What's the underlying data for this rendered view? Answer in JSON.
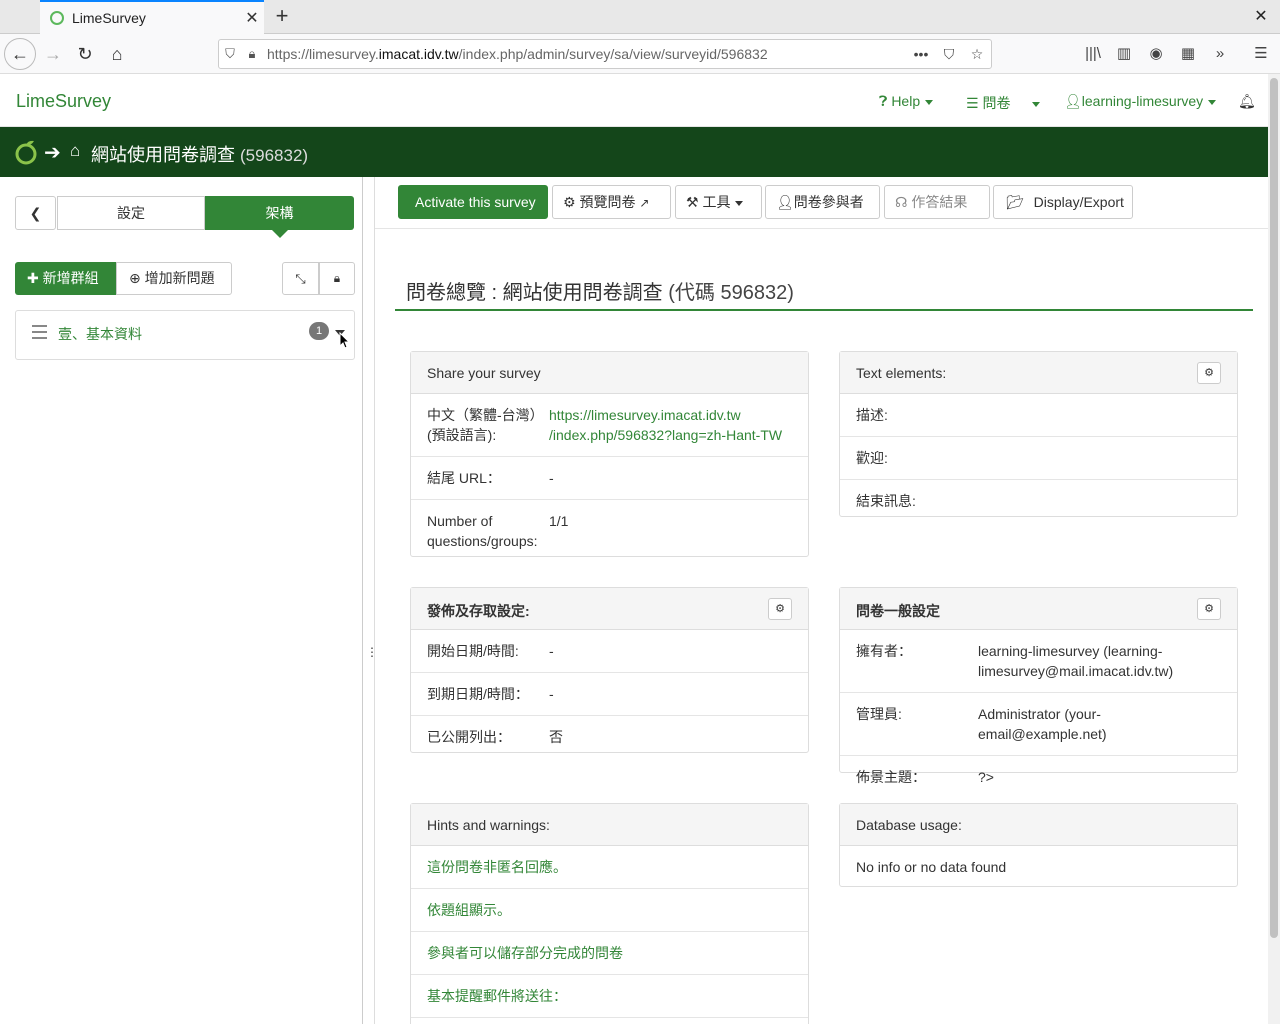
{
  "browser": {
    "tab_title": "LimeSurvey",
    "url_prefix": "https://limesurvey.",
    "url_domain": "imacat.idv.tw",
    "url_path": "/index.php/admin/survey/sa/view/surveyid/596832"
  },
  "app": {
    "brand": "LimeSurvey",
    "help_label": "Help",
    "surveys_label": "問卷",
    "user_label": "learning-limesurvey"
  },
  "titlebar": {
    "title": "網站使用問卷調查",
    "code": "(596832)"
  },
  "sidebar": {
    "settings_tab": "設定",
    "structure_tab": "架構",
    "add_group": "新增群組",
    "add_question": "增加新問題",
    "group_name": "壹、基本資料",
    "group_count": "1"
  },
  "toolbar": {
    "activate": "Activate this survey",
    "preview": "預覽問卷",
    "tools": "工具",
    "participants": "問卷參與者",
    "responses": "作答結果",
    "display_export": "Display/Export"
  },
  "main": {
    "heading_prefix": "問卷總覽",
    "heading_sep": " : ",
    "heading_title": "網站使用問卷調查",
    "heading_code": "(代碼 596832)"
  },
  "share_panel": {
    "title": "Share your survey",
    "lang_label": "中文（繁體-台灣）(預設語言):",
    "lang_link_1": "https://limesurvey.imacat.idv.tw",
    "lang_link_2": "/index.php/596832?lang=zh-Hant-TW",
    "end_url_label": "結尾 URL：",
    "end_url_value": "-",
    "count_label": "Number of questions/groups:",
    "count_value": "1/1"
  },
  "text_panel": {
    "title": "Text elements:",
    "desc_label": "描述:",
    "welcome_label": "歡迎:",
    "end_label": "結束訊息:"
  },
  "publish_panel": {
    "title": "發佈及存取設定:",
    "start_label": "開始日期/時間:",
    "start_value": "-",
    "expiry_label": "到期日期/時間：",
    "expiry_value": "-",
    "public_label": "已公開列出：",
    "public_value": "否"
  },
  "general_panel": {
    "title": "問卷一般設定",
    "owner_label": "擁有者：",
    "owner_value": "learning-limesurvey (learning-limesurvey@mail.imacat.idv.tw)",
    "admin_label": "管理員:",
    "admin_value": "Administrator (your-email@example.net)",
    "theme_label": "佈景主題：",
    "theme_value": "?>"
  },
  "hints_panel": {
    "title": "Hints and warnings:",
    "items": [
      "這份問卷非匿名回應。",
      "依題組顯示。",
      "參與者可以儲存部分完成的問卷",
      "基本提醒郵件將送往："
    ]
  },
  "db_panel": {
    "title": "Database usage:",
    "value": "No info or no data found"
  },
  "colors": {
    "accent": "#328637",
    "titlebar": "#14461a"
  }
}
